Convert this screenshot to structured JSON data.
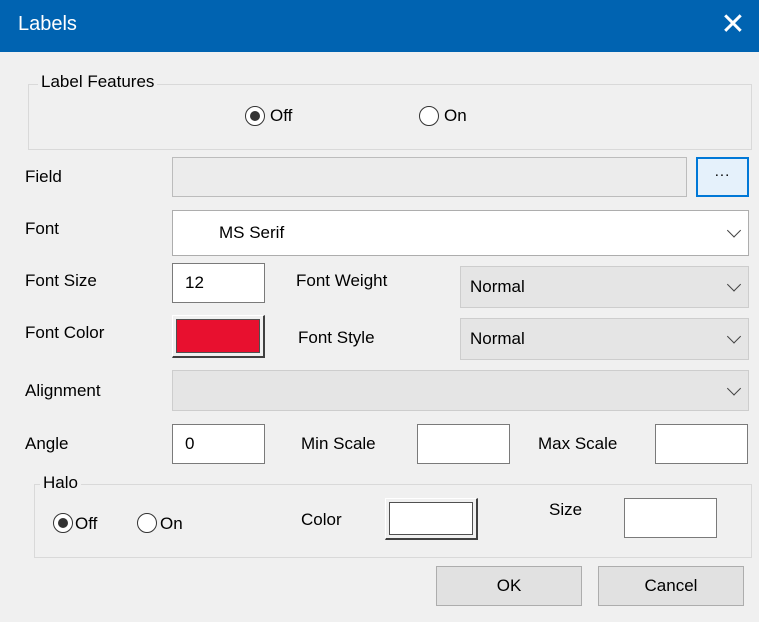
{
  "window": {
    "title": "Labels",
    "close_glyph": "✕"
  },
  "label_features": {
    "legend": "Label Features",
    "off_label": "Off",
    "on_label": "On",
    "selected": "Off"
  },
  "field": {
    "label": "Field",
    "value": "",
    "browse_label": "..."
  },
  "font": {
    "label": "Font",
    "value": "MS Serif"
  },
  "font_size": {
    "label": "Font Size",
    "value": "12"
  },
  "font_weight": {
    "label": "Font Weight",
    "value": "Normal"
  },
  "font_color": {
    "label": "Font Color",
    "color": "#e8102f"
  },
  "font_style": {
    "label": "Font Style",
    "value": "Normal"
  },
  "alignment": {
    "label": "Alignment",
    "value": ""
  },
  "angle": {
    "label": "Angle",
    "value": "0"
  },
  "min_scale": {
    "label": "Min Scale",
    "value": ""
  },
  "max_scale": {
    "label": "Max Scale",
    "value": ""
  },
  "halo": {
    "legend": "Halo",
    "off_label": "Off",
    "on_label": "On",
    "selected": "Off",
    "color_label": "Color",
    "color": "#ffffff",
    "size_label": "Size",
    "size_value": ""
  },
  "buttons": {
    "ok": "OK",
    "cancel": "Cancel"
  },
  "colors": {
    "titlebar": "#0063b1",
    "dialog_bg": "#f0f0f0",
    "focus_border": "#0078d7"
  }
}
